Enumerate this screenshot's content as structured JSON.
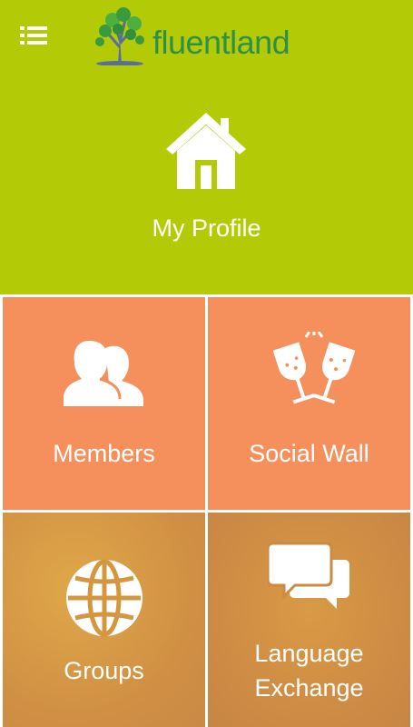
{
  "header": {
    "menu_icon": "list-menu-icon",
    "logo_text": "fluentland",
    "logo_icon": "tree-icon"
  },
  "tiles": [
    {
      "id": "my_profile",
      "label": "My Profile",
      "icon": "home-icon"
    },
    {
      "id": "members",
      "label": "Members",
      "icon": "users-icon"
    },
    {
      "id": "social_wall",
      "label": "Social Wall",
      "icon": "champagne-toast-icon"
    },
    {
      "id": "groups",
      "label": "Groups",
      "icon": "globe-icon"
    },
    {
      "id": "language_exchange",
      "label_line1": "Language",
      "label_line2": "Exchange",
      "icon": "chat-bubbles-icon"
    }
  ],
  "colors": {
    "profile_bg": "#b2cb06",
    "members_bg": "#f5905d",
    "social_bg": "#f5905d",
    "groups_bg": "#d4963f",
    "language_bg": "#cc8a44",
    "logo_text": "#2f8f4a"
  }
}
